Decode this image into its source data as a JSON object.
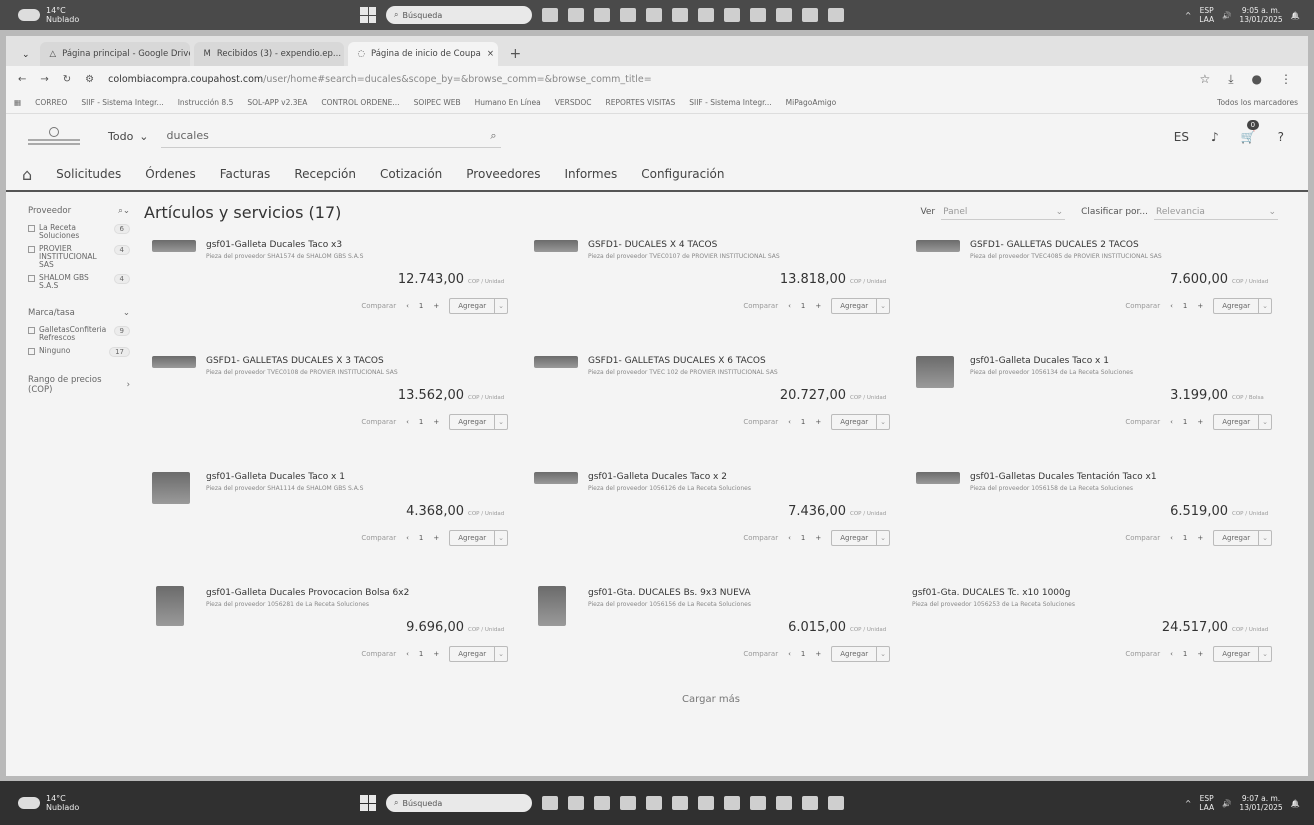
{
  "os": {
    "weather_temp": "14°C",
    "weather_desc": "Nublado",
    "search_placeholder": "Búsqueda",
    "lang": "ESP",
    "lang2": "LAA",
    "time_top": "9:05 a. m.",
    "time_bottom": "9:07 a. m.",
    "date": "13/01/2025"
  },
  "browser": {
    "tabs": [
      {
        "label": "Página principal - Google Drive"
      },
      {
        "label": "Recibidos (3) - expendio.ep..."
      },
      {
        "label": "Página de inicio de Coupa"
      }
    ],
    "url_host": "colombiacompra.coupahost.com",
    "url_path": "/user/home#search=ducales&scope_by=&browse_comm=&browse_comm_title=",
    "bookmarks": [
      "CORREO",
      "SIIF - Sistema Integr...",
      "Instrucción 8.5",
      "SOL-APP v2.3EA",
      "CONTROL ORDENE...",
      "SOIPEC WEB",
      "Humano En Línea",
      "VERSDOC",
      "REPORTES VISITAS",
      "SIIF - Sistema Integr...",
      "MiPagoAmigo"
    ],
    "all_bookmarks": "Todos los marcadores"
  },
  "header": {
    "scope": "Todo",
    "search_value": "ducales",
    "lang": "ES",
    "cart_count": "0",
    "help": "?"
  },
  "nav": [
    "Solicitudes",
    "Órdenes",
    "Facturas",
    "Recepción",
    "Cotización",
    "Proveedores",
    "Informes",
    "Configuración"
  ],
  "sidebar": {
    "supplier_label": "Proveedor",
    "suppliers": [
      {
        "name": "La Receta Soluciones",
        "count": "6"
      },
      {
        "name": "PROVIER INSTITUCIONAL SAS",
        "count": "4"
      },
      {
        "name": "SHALOM GBS S.A.S",
        "count": "4"
      }
    ],
    "brand_label": "Marca/tasa",
    "brands": [
      {
        "name": "GalletasConfiteria Refrescos",
        "count": "9"
      },
      {
        "name": "Ninguno",
        "count": "17"
      }
    ],
    "price_label": "Rango de precios (COP)"
  },
  "main": {
    "title": "Artículos y servicios (17)",
    "view_label": "Ver",
    "view_value": "Panel",
    "sort_label": "Clasificar por...",
    "sort_value": "Relevancia",
    "load_more": "Cargar más"
  },
  "products": [
    {
      "title": "gsf01-Galleta Ducales Taco x3",
      "supplier": "Pieza del proveedor SHA1574 de SHALOM GBS S.A.S",
      "price": "12.743,00",
      "unit": "COP / Unidad",
      "thumb": "flat"
    },
    {
      "title": "GSFD1- DUCALES X 4 TACOS",
      "supplier": "Pieza del proveedor TVEC0107 de PROVIER INSTITUCIONAL SAS",
      "price": "13.818,00",
      "unit": "COP / Unidad",
      "thumb": "flat"
    },
    {
      "title": "GSFD1- GALLETAS DUCALES 2 TACOS",
      "supplier": "Pieza del proveedor TVEC4085 de PROVIER INSTITUCIONAL SAS",
      "price": "7.600,00",
      "unit": "COP / Unidad",
      "thumb": "flat"
    },
    {
      "title": "GSFD1- GALLETAS DUCALES X 3 TACOS",
      "supplier": "Pieza del proveedor TVEC0108 de PROVIER INSTITUCIONAL SAS",
      "price": "13.562,00",
      "unit": "COP / Unidad",
      "thumb": "flat"
    },
    {
      "title": "GSFD1- GALLETAS DUCALES X 6 TACOS",
      "supplier": "Pieza del proveedor TVEC 102 de PROVIER INSTITUCIONAL SAS",
      "price": "20.727,00",
      "unit": "COP / Unidad",
      "thumb": "flat"
    },
    {
      "title": "gsf01-Galleta Ducales Taco x 1",
      "supplier": "Pieza del proveedor 1056134 de La Receta Soluciones",
      "price": "3.199,00",
      "unit": "COP / Bolsa",
      "thumb": "box"
    },
    {
      "title": "gsf01-Galleta Ducales Taco x 1",
      "supplier": "Pieza del proveedor SHA1114 de SHALOM GBS S.A.S",
      "price": "4.368,00",
      "unit": "COP / Unidad",
      "thumb": "box"
    },
    {
      "title": "gsf01-Galleta Ducales Taco x 2",
      "supplier": "Pieza del proveedor 1056126 de La Receta Soluciones",
      "price": "7.436,00",
      "unit": "COP / Unidad",
      "thumb": "flat"
    },
    {
      "title": "gsf01-Galletas Ducales Tentación Taco x1",
      "supplier": "Pieza del proveedor 1056158 de La Receta Soluciones",
      "price": "6.519,00",
      "unit": "COP / Unidad",
      "thumb": "flat"
    },
    {
      "title": "gsf01-Galleta Ducales Provocacion Bolsa 6x2",
      "supplier": "Pieza del proveedor 1056281 de La Receta Soluciones",
      "price": "9.696,00",
      "unit": "COP / Unidad",
      "thumb": "tall"
    },
    {
      "title": "gsf01-Gta. DUCALES Bs. 9x3 NUEVA",
      "supplier": "Pieza del proveedor 1056156 de La Receta Soluciones",
      "price": "6.015,00",
      "unit": "COP / Unidad",
      "thumb": "tall"
    },
    {
      "title": "gsf01-Gta. DUCALES Tc. x10 1000g",
      "supplier": "Pieza del proveedor 1056253 de La Receta Soluciones",
      "price": "24.517,00",
      "unit": "COP / Unidad",
      "thumb": "none"
    }
  ],
  "card_actions": {
    "compare": "Comparar",
    "qty": "1",
    "add": "Agregar"
  }
}
